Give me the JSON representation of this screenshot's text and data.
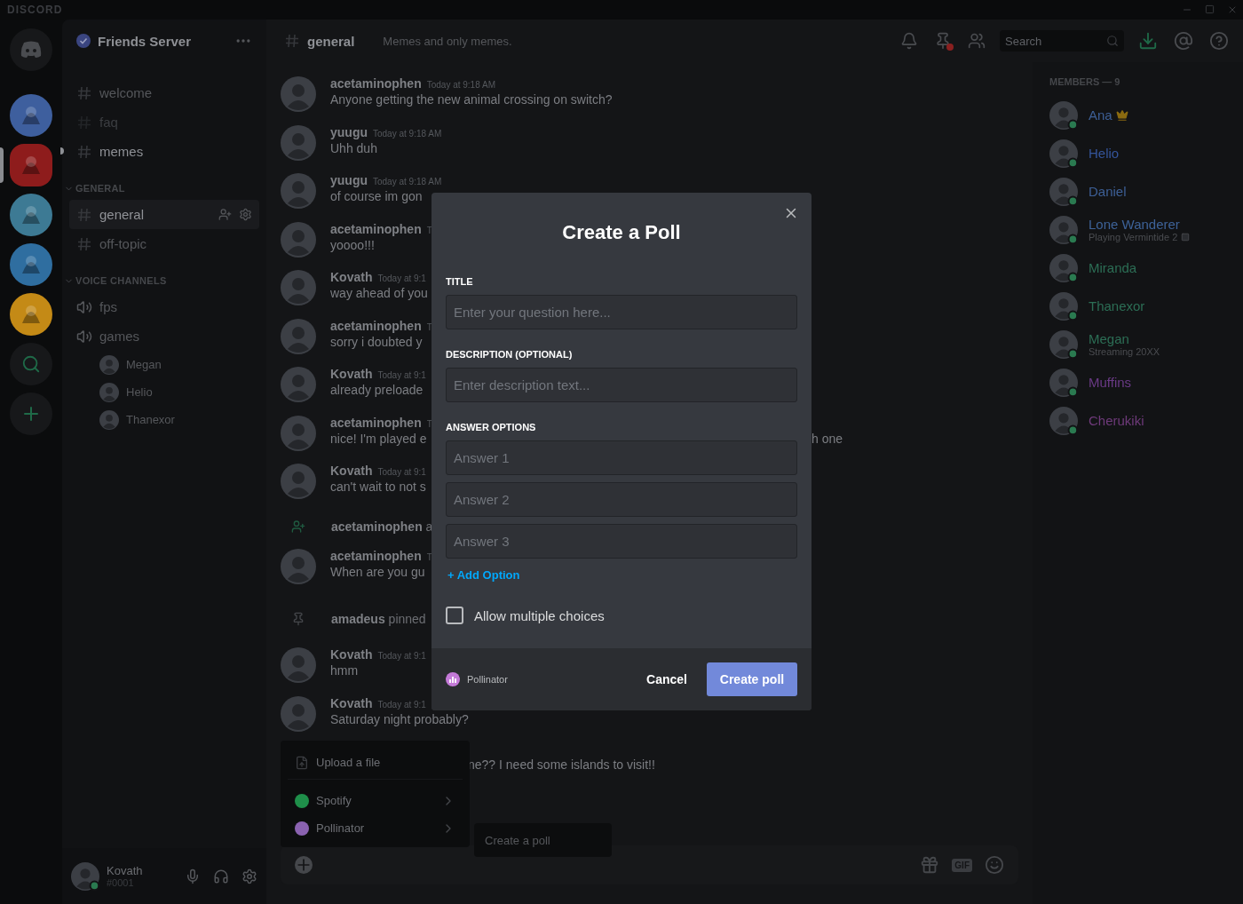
{
  "titlebar": {
    "logo": "DISCORD"
  },
  "servers": [
    {
      "kind": "home",
      "selected": false
    },
    {
      "kind": "server",
      "color": "#3e5f9e",
      "selected": false
    },
    {
      "kind": "server",
      "color": "#8e1c1c",
      "selected": true
    },
    {
      "kind": "server",
      "color": "#3d7a94",
      "selected": false
    },
    {
      "kind": "server",
      "color": "#2f6ea0",
      "selected": false
    },
    {
      "kind": "server",
      "color": "#c48a16",
      "selected": false
    },
    {
      "kind": "search",
      "selected": false
    },
    {
      "kind": "add",
      "selected": false
    }
  ],
  "server": {
    "name": "Friends Server",
    "verified": true
  },
  "channels": [
    {
      "name": "welcome",
      "selected": false,
      "unread": false,
      "muted": false
    },
    {
      "name": "faq",
      "selected": false,
      "unread": false,
      "muted": true
    },
    {
      "name": "memes",
      "selected": false,
      "unread": true,
      "muted": false
    }
  ],
  "categories": [
    {
      "name": "GENERAL",
      "expanded": true,
      "kind": "text",
      "channels": [
        {
          "name": "general",
          "selected": true,
          "unread": false,
          "muted": false
        },
        {
          "name": "off-topic",
          "selected": false,
          "unread": false,
          "muted": false
        }
      ]
    },
    {
      "name": "VOICE CHANNELS",
      "expanded": true,
      "kind": "voice",
      "channels": [
        {
          "name": "fps",
          "selected": false,
          "unread": false,
          "muted": false
        },
        {
          "name": "games",
          "selected": false,
          "unread": false,
          "muted": false,
          "users": [
            {
              "name": "Megan"
            },
            {
              "name": "Helio"
            },
            {
              "name": "Thanexor"
            }
          ]
        }
      ]
    }
  ],
  "user_panel": {
    "name": "Kovath",
    "tag": "#0001"
  },
  "chat_header": {
    "channel": "general",
    "topic": "Memes and only memes.",
    "pins_unread": true,
    "search": {
      "placeholder": "Search"
    }
  },
  "messages": [
    {
      "kind": "message",
      "author": "acetaminophen",
      "time": "Today at 9:18 AM",
      "text": "Anyone getting the new animal crossing on switch?"
    },
    {
      "kind": "message",
      "author": "yuugu",
      "time": "Today at 9:18 AM",
      "text": "Uhh duh"
    },
    {
      "kind": "message",
      "author": "yuugu",
      "time": "Today at 9:18 AM",
      "text": "of course im gon"
    },
    {
      "kind": "message",
      "author": "acetaminophen",
      "time": "T",
      "text": "yoooo!!!"
    },
    {
      "kind": "message",
      "author": "Kovath",
      "time": "Today at 9:1",
      "text": "way ahead of you"
    },
    {
      "kind": "message",
      "author": "acetaminophen",
      "time": "T",
      "text": "sorry i doubted y"
    },
    {
      "kind": "message",
      "author": "Kovath",
      "time": "Today at 9:1",
      "text": "already preloade"
    },
    {
      "kind": "message",
      "author": "acetaminophen",
      "time": "T",
      "text": "nice! I'm played e",
      "tail": "h one"
    },
    {
      "kind": "message",
      "author": "Kovath",
      "time": "Today at 9:1",
      "text": "can't wait to not s"
    },
    {
      "kind": "join",
      "author": "acetaminophen",
      "text": "a"
    },
    {
      "kind": "message",
      "author": "acetaminophen",
      "time": "T",
      "text": "When are you gu"
    },
    {
      "kind": "pin",
      "author": "amadeus",
      "text": "pinned"
    },
    {
      "kind": "message",
      "author": "Kovath",
      "time": "Today at 9:1",
      "text": "hmm"
    },
    {
      "kind": "message",
      "author": "Kovath",
      "time": "Today at 9:1",
      "text": "Saturday night probably?"
    },
    {
      "kind": "partial",
      "text": "ne?? I need some islands to visit!!"
    }
  ],
  "attach_menu": {
    "items": [
      {
        "kind": "upload",
        "label": "Upload a file",
        "submenu": false
      },
      {
        "kind": "app",
        "label": "Spotify",
        "color": "#1f8f4a",
        "submenu": true
      },
      {
        "kind": "app",
        "label": "Pollinator",
        "color": "#8a62b0",
        "submenu": true
      }
    ],
    "submenu": [
      "Create a poll"
    ]
  },
  "composer": {
    "gif": "GIF"
  },
  "members": {
    "heading": "MEMBERS — 9",
    "list": [
      {
        "name": "Ana",
        "color": "#3d5f96",
        "owner": true
      },
      {
        "name": "Helio",
        "color": "#34549a",
        "owner": false
      },
      {
        "name": "Daniel",
        "color": "#3d5f96",
        "owner": false
      },
      {
        "name": "Lone Wanderer",
        "color": "#3d6298",
        "owner": false,
        "activity": {
          "kind": "playing",
          "text": "Playing Vermintide 2"
        }
      },
      {
        "name": "Miranda",
        "color": "#2c6e55",
        "owner": false
      },
      {
        "name": "Thanexor",
        "color": "#2c6e55",
        "owner": false
      },
      {
        "name": "Megan",
        "color": "#2c6e55",
        "owner": false,
        "activity": {
          "kind": "streaming",
          "text": "Streaming 20XX"
        }
      },
      {
        "name": "Muffins",
        "color": "#6a3a86",
        "owner": false
      },
      {
        "name": "Cherukiki",
        "color": "#6e3a7a",
        "owner": false
      }
    ]
  },
  "poll_dialog": {
    "title": "Create a Poll",
    "fields": [
      {
        "label": "TITLE",
        "placeholder": "Enter your question here..."
      },
      {
        "label": "DESCRIPTION (OPTIONAL)",
        "placeholder": "Enter description text..."
      }
    ],
    "answers_label": "ANSWER OPTIONS",
    "answers": [
      {
        "placeholder": "Answer 1"
      },
      {
        "placeholder": "Answer 2"
      },
      {
        "placeholder": "Answer 3"
      }
    ],
    "add_option": "+ Add Option",
    "multiple": {
      "label": "Allow multiple choices",
      "checked": false
    },
    "app": "Pollinator",
    "cancel": "Cancel",
    "submit": "Create poll"
  }
}
